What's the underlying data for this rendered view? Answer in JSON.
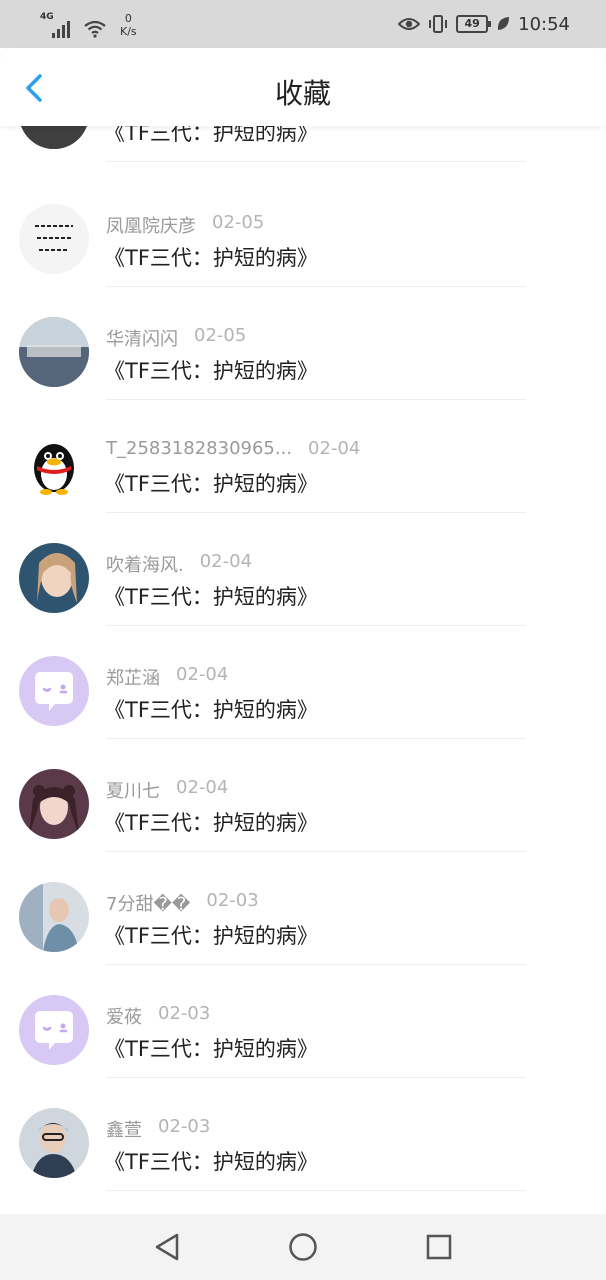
{
  "status_bar": {
    "network": "4G",
    "speed_value": "0",
    "speed_unit": "K/s",
    "battery": "49",
    "time": "10:54"
  },
  "header": {
    "title": "收藏"
  },
  "items": [
    {
      "name": "",
      "date": "",
      "message": "《TF三代：护短的病》",
      "avatar_color": "#5f5f5f"
    },
    {
      "name": "凤凰院庆彦",
      "date": "02-05",
      "message": "《TF三代：护短的病》",
      "avatar_color": "#f2f2f2"
    },
    {
      "name": "华清闪闪",
      "date": "02-05",
      "message": "《TF三代：护短的病》",
      "avatar_color": "#6f7f8f"
    },
    {
      "name": "T_2583182830965...",
      "date": "02-04",
      "message": "《TF三代：护短的病》",
      "avatar_color": "#ffffff"
    },
    {
      "name": "吹着海风.",
      "date": "02-04",
      "message": "《TF三代：护短的病》",
      "avatar_color": "#3c5a72"
    },
    {
      "name": "郑芷涵",
      "date": "02-04",
      "message": "《TF三代：护短的病》",
      "avatar_color": "#d8c8f4"
    },
    {
      "name": "夏川七",
      "date": "02-04",
      "message": "《TF三代：护短的病》",
      "avatar_color": "#4a2e3a"
    },
    {
      "name": "7分甜��",
      "date": "02-03",
      "message": "《TF三代：护短的病》",
      "avatar_color": "#b9c8d6"
    },
    {
      "name": "爱莜",
      "date": "02-03",
      "message": "《TF三代：护短的病》",
      "avatar_color": "#d8c8f4"
    },
    {
      "name": "鑫萱",
      "date": "02-03",
      "message": "《TF三代：护短的病》",
      "avatar_color": "#3e4b5c"
    }
  ],
  "colors": {
    "accent": "#2a9df4",
    "status_bg": "#d9d9d9",
    "nav_bg": "#f3f3f3"
  },
  "icons": {
    "back": "chevron-left-icon",
    "nav": [
      "back-triangle-icon",
      "home-circle-icon",
      "recents-square-icon"
    ]
  }
}
